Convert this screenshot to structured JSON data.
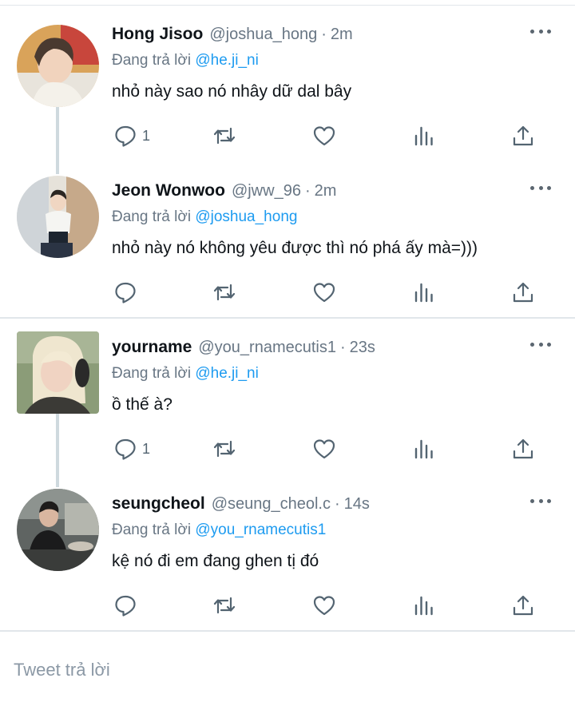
{
  "tweets": [
    {
      "name": "Hong Jisoo",
      "handle": "@joshua_hong",
      "time": "2m",
      "reply_prefix": "Đang trả lời",
      "reply_to": "@he.ji_ni",
      "text": "nhỏ này sao nó nhây dữ dal bây",
      "reply_count": "1",
      "avatar_icon": "avatar-photo"
    },
    {
      "name": "Jeon Wonwoo",
      "handle": "@jww_96",
      "time": "2m",
      "reply_prefix": "Đang trả lời",
      "reply_to": "@joshua_hong",
      "text": "nhỏ này nó không yêu được thì nó phá ấy mà=)))",
      "reply_count": "",
      "avatar_icon": "avatar-photo"
    },
    {
      "name": "yourname",
      "handle": "@you_rnamecutis1",
      "time": "23s",
      "reply_prefix": "Đang trả lời",
      "reply_to": "@he.ji_ni",
      "text": "ồ thế à?",
      "reply_count": "1",
      "avatar_icon": "avatar-photo"
    },
    {
      "name": "seungcheol",
      "handle": "@seung_cheol.c",
      "time": "14s",
      "reply_prefix": "Đang trả lời",
      "reply_to": "@you_rnamecutis1",
      "text": "kệ nó đi em đang ghen tị đó",
      "reply_count": "",
      "avatar_icon": "avatar-photo"
    }
  ],
  "separator": "·",
  "compose": {
    "placeholder": "Tweet trả lời"
  },
  "icons": [
    "more-icon",
    "reply-icon",
    "retweet-icon",
    "like-icon",
    "analytics-icon",
    "share-icon"
  ],
  "colors": {
    "accent": "#1d9bf0",
    "muted": "#687684",
    "text": "#0f1419"
  }
}
